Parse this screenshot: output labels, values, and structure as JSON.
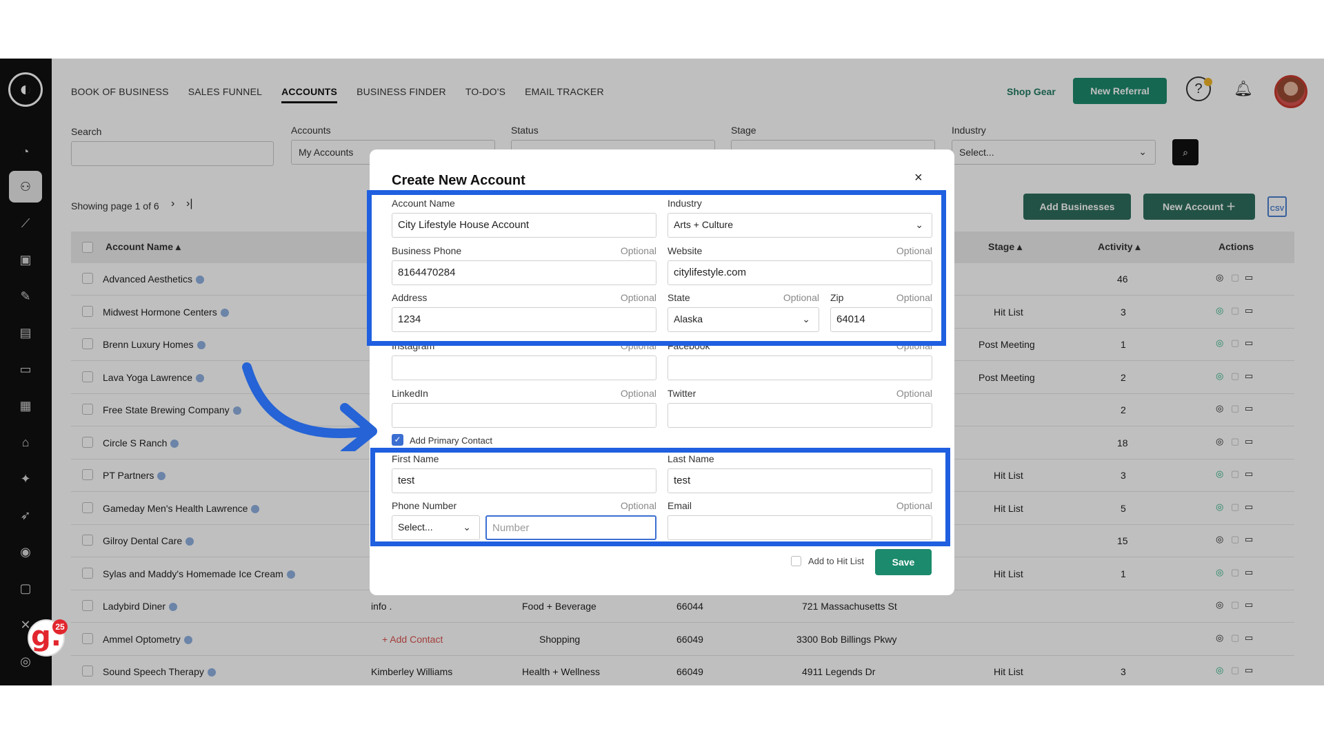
{
  "nav": {
    "items": [
      "BOOK OF BUSINESS",
      "SALES FUNNEL",
      "ACCOUNTS",
      "BUSINESS FINDER",
      "TO-DO'S",
      "EMAIL TRACKER"
    ],
    "shop_gear": "Shop Gear",
    "new_referral": "New Referral"
  },
  "filters": {
    "search_label": "Search",
    "accounts_label": "Accounts",
    "accounts_value": "My Accounts",
    "status_label": "Status",
    "stage_label": "Stage",
    "industry_label": "Industry",
    "industry_value": "Select..."
  },
  "toolbar": {
    "showing": "Showing page 1 of 6",
    "add_businesses": "Add Businesses",
    "new_account": "New Account",
    "csv": "CSV"
  },
  "table": {
    "headers": {
      "account_name": "Account Name",
      "stage": "Stage",
      "activity": "Activity",
      "actions": "Actions"
    },
    "rows": [
      {
        "name": "Advanced Aesthetics",
        "contact": "",
        "industry": "",
        "zip": "",
        "address": "",
        "stage": "",
        "activity": "46"
      },
      {
        "name": "Midwest Hormone Centers",
        "contact": "",
        "industry": "",
        "zip": "",
        "address": "",
        "stage": "Hit List",
        "activity": "3"
      },
      {
        "name": "Brenn Luxury Homes",
        "contact": "",
        "industry": "",
        "zip": "",
        "address": "",
        "stage": "Post Meeting",
        "activity": "1"
      },
      {
        "name": "Lava Yoga Lawrence",
        "contact": "",
        "industry": "",
        "zip": "",
        "address": "",
        "stage": "Post Meeting",
        "activity": "2"
      },
      {
        "name": "Free State Brewing Company",
        "contact": "",
        "industry": "",
        "zip": "",
        "address": "",
        "stage": "",
        "activity": "2"
      },
      {
        "name": "Circle S Ranch",
        "contact": "",
        "industry": "",
        "zip": "",
        "address": "",
        "stage": "",
        "activity": "18"
      },
      {
        "name": "PT Partners",
        "contact": "",
        "industry": "",
        "zip": "",
        "address": "",
        "stage": "Hit List",
        "activity": "3"
      },
      {
        "name": "Gameday Men's Health Lawrence",
        "contact": "",
        "industry": "",
        "zip": "",
        "address": "",
        "stage": "Hit List",
        "activity": "5"
      },
      {
        "name": "Gilroy Dental Care",
        "contact": "",
        "industry": "",
        "zip": "",
        "address": "",
        "stage": "",
        "activity": "15"
      },
      {
        "name": "Sylas and Maddy's Homemade Ice Cream",
        "contact": "",
        "industry": "",
        "zip": "",
        "address": "",
        "stage": "Hit List",
        "activity": "1"
      },
      {
        "name": "Ladybird Diner",
        "contact": "info .",
        "industry": "Food + Beverage",
        "zip": "66044",
        "address": "721 Massachusetts St",
        "stage": "",
        "activity": ""
      },
      {
        "name": "Ammel Optometry",
        "contact": "+ Add Contact",
        "industry": "Shopping",
        "zip": "66049",
        "address": "3300 Bob Billings Pkwy",
        "stage": "",
        "activity": ""
      },
      {
        "name": "Sound Speech Therapy",
        "contact": "Kimberley Williams",
        "industry": "Health + Wellness",
        "zip": "66049",
        "address": "4911 Legends Dr",
        "stage": "Hit List",
        "activity": "3"
      }
    ]
  },
  "modal": {
    "title": "Create New Account",
    "close": "×",
    "optional": "Optional",
    "account_name_label": "Account Name",
    "account_name_value": "City Lifestyle House Account",
    "industry_label": "Industry",
    "industry_value": "Arts + Culture",
    "business_phone_label": "Business Phone",
    "business_phone_value": "8164470284",
    "website_label": "Website",
    "website_value": "citylifestyle.com",
    "address_label": "Address",
    "address_value": "1234",
    "state_label": "State",
    "state_value": "Alaska",
    "zip_label": "Zip",
    "zip_value": "64014",
    "instagram_label": "Instagram",
    "facebook_label": "Facebook",
    "linkedin_label": "LinkedIn",
    "twitter_label": "Twitter",
    "add_primary_contact": "Add Primary Contact",
    "first_name_label": "First Name",
    "first_name_value": "test",
    "last_name_label": "Last Name",
    "last_name_value": "test",
    "phone_label": "Phone Number",
    "phone_country_value": "Select...",
    "phone_number_placeholder": "Number",
    "email_label": "Email",
    "add_to_hit_list": "Add to Hit List",
    "save": "Save"
  },
  "badge": {
    "count": "25",
    "letter": "g."
  },
  "colors": {
    "accent_green": "#1c8a6c",
    "highlight_blue": "#1f5fe0",
    "arrow_blue": "#2563d6"
  }
}
